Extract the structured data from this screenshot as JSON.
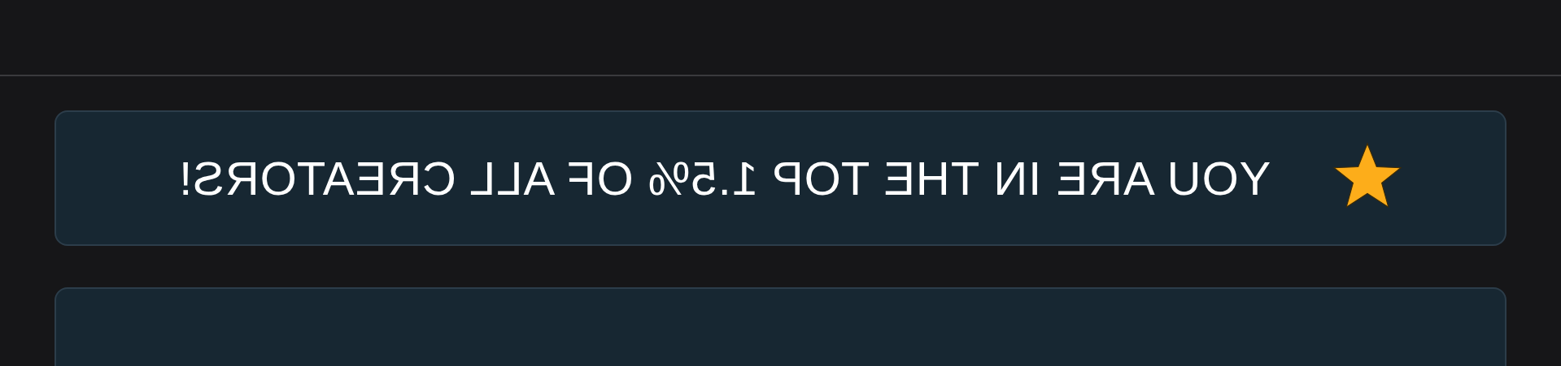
{
  "banner": {
    "text": "YOU ARE IN THE TOP 1.5% OF ALL CREATORS!"
  }
}
